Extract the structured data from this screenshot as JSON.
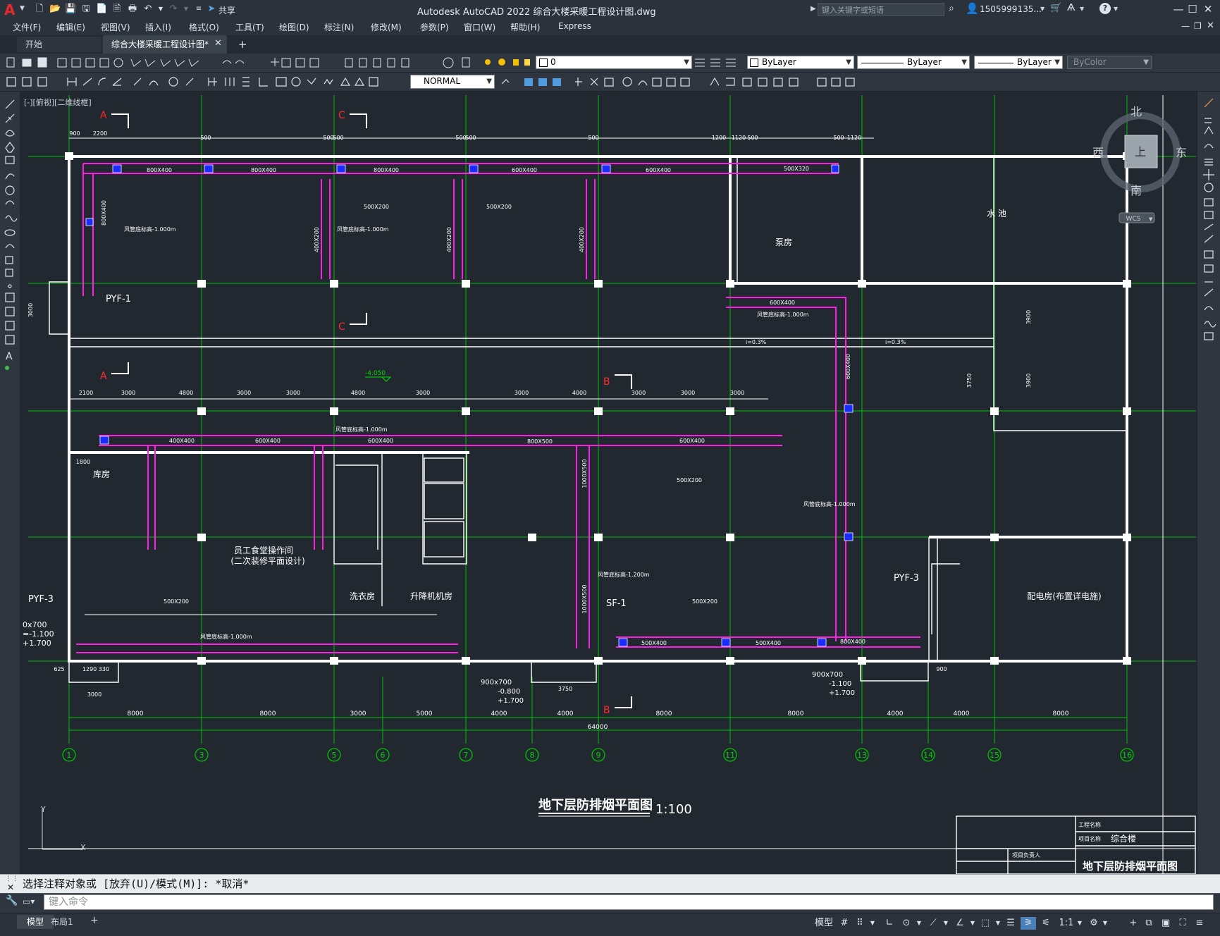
{
  "titlebar": {
    "app_logo": "A",
    "share_label": "共享",
    "window_title": "Autodesk AutoCAD 2022    综合大楼采暖工程设计图.dwg",
    "search_placeholder": "键入关键字或短语",
    "user_name": "1505999135...",
    "icons": [
      "new-icon",
      "open-icon",
      "save-icon",
      "saveas-icon",
      "open-web-icon",
      "save-web-icon",
      "plot-icon",
      "undo-icon",
      "redo-icon",
      "share-icon",
      "search-icon",
      "user-icon",
      "cart-icon",
      "a360-icon",
      "help-icon"
    ]
  },
  "menu": {
    "items": [
      "文件(F)",
      "编辑(E)",
      "视图(V)",
      "插入(I)",
      "格式(O)",
      "工具(T)",
      "绘图(D)",
      "标注(N)",
      "修改(M)",
      "参数(P)",
      "窗口(W)",
      "帮助(H)",
      "Express"
    ]
  },
  "tabs": {
    "start": "开始",
    "document": "综合大楼采暖工程设计图*",
    "add": "+"
  },
  "toolbar": {
    "layer_value": "0",
    "color_value": "ByLayer",
    "linetype_value": "ByLayer",
    "lineweight_value": "ByLayer",
    "plotstyle_value": "ByColor",
    "textstyle_value": "NORMAL"
  },
  "viewport": {
    "label": "[-][俯视][二维线框]"
  },
  "viewcube": {
    "north": "北",
    "south": "南",
    "east": "东",
    "west": "西",
    "top": "上",
    "wcs": "WCS"
  },
  "drawing": {
    "title": "地下层防排烟平面图",
    "scale": "1:100",
    "rooms": {
      "pump_room": "泵房",
      "pool": "水  池",
      "storage": "库房",
      "kitchen": "员工食堂操作间",
      "kitchen_note": "(二次装修平面设计)",
      "laundry": "洗衣房",
      "elevator_room": "升降机机房",
      "power_room": "配电房(布置详电施)"
    },
    "fans": {
      "pyf3_left": "PYF-3",
      "pyf1": "PYF-1",
      "pyf3_right": "PYF-3",
      "sf1": "SF-1"
    },
    "sections": [
      "A",
      "C",
      "C",
      "A",
      "B",
      "B"
    ],
    "elevation": "-4.050",
    "axes": [
      "1",
      "3",
      "5",
      "6",
      "7",
      "8",
      "9",
      "11",
      "13",
      "14",
      "15",
      "16"
    ],
    "dims_bottom": [
      "8000",
      "8000",
      "3000",
      "5000",
      "4000",
      "4000",
      "8000",
      "8000",
      "4000",
      "4000",
      "8000"
    ],
    "total_dim": "64000",
    "dims_top": [
      "900",
      "2200",
      "500",
      "500",
      "500",
      "500",
      "500",
      "500",
      "1200",
      "1120",
      "500",
      "500",
      "1120"
    ],
    "dims_middle": [
      "2100",
      "3000",
      "4800",
      "3000",
      "3000",
      "4800",
      "3000",
      "3000",
      "4000",
      "3000",
      "3000",
      "3000"
    ],
    "duct_labels": {
      "top1": "800X400",
      "top2": "800X400",
      "top3": "800X400",
      "top4": "600X400",
      "top5": "600X400",
      "top6": "500X320",
      "mid1": "400X400",
      "mid2": "600X400",
      "mid3": "600X400",
      "mid4": "800X500",
      "mid5": "600X400",
      "right1": "600X400",
      "right_v": "600X400",
      "bottom1": "500X400",
      "bottom2": "500X400",
      "bottom3": "800X400",
      "v1": "400X200",
      "v2": "400X200",
      "v3": "400X200",
      "v4": "800X400",
      "v5": "1000X500",
      "v6": "1000X500"
    },
    "notes": {
      "n1": "风管底标高-1.000m",
      "n2": "风管底标高-1.000m",
      "n3": "风管底标高-1.000m",
      "n4": "风管底标高-1.000m",
      "n5": "风管底标高-1.200m",
      "n6": "风管底标高-1.000m",
      "n7": "风管底标高-1.000m",
      "slope1": "i=0.3%",
      "slope2": "i=0.3%",
      "grille1": "500X200",
      "grille2": "500X200",
      "grille3": "500X200",
      "grille4": "500X200",
      "grille5": "500X200",
      "louver_left": "0x700",
      "louver_left2": "=-1.100",
      "louver_left3": "+1.700",
      "louver_mid1": "900x700",
      "louver_mid2": "-0.800",
      "louver_mid3": "+1.700",
      "louver_right1": "900x700",
      "louver_right2": "-1.100",
      "louver_right3": "+1.700",
      "dim_3750": "3750",
      "dim_3000": "3000",
      "dim_3900a": "3900",
      "dim_3900b": "3900",
      "dim_1800": "1800",
      "dim_625": "625",
      "dim_1290": "1290 330",
      "dim_3000b": "3000",
      "dim_900": "900",
      "dim_3750b": "3750"
    }
  },
  "titleblock": {
    "project_label": "工程名称",
    "item_label": "项目名称",
    "item_value": "综合楼",
    "manager": "项目负责人",
    "drawing_name": "地下层防排烟平面图"
  },
  "command": {
    "history": "选择注释对象或 [放弃(U)/模式(M)]: *取消*",
    "placeholder": "键入命令"
  },
  "status": {
    "model_tab": "模型",
    "layout_tab": "布局1",
    "add_tab": "+",
    "model_space": "模型",
    "scale": "1:1",
    "icons": [
      "grid-icon",
      "snap-icon",
      "ortho-icon",
      "polar-icon",
      "osnap-icon",
      "otrack-icon",
      "lineweight-icon",
      "selection-cycling-icon",
      "annotation-scale-icon",
      "workspace-icon",
      "units-icon",
      "isolate-icon",
      "fullscreen-icon",
      "customize-icon"
    ]
  },
  "colors": {
    "background": "#212830",
    "duct": "#ff1ee6",
    "walls": "#ffffff",
    "grid": "#00d000",
    "axis_bubble": "#00d000",
    "section": "#ff2222",
    "damper": "#1a2cff"
  }
}
